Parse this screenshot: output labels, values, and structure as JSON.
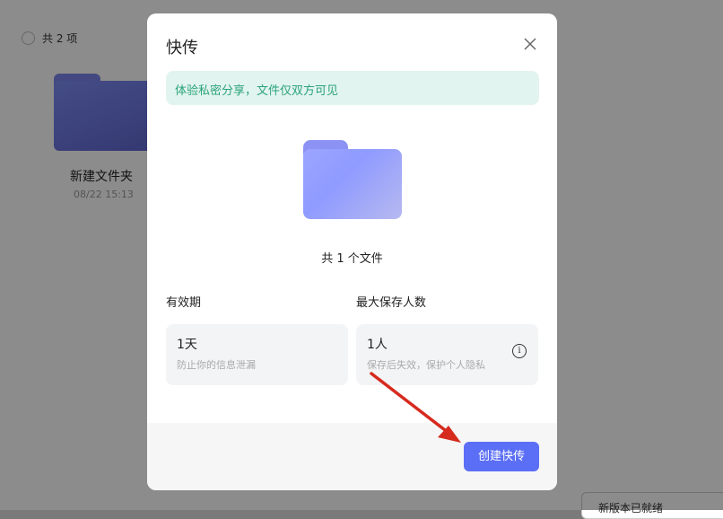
{
  "background": {
    "item_count": "共 2 项",
    "folder_name": "新建文件夹",
    "folder_date": "08/22 15:13",
    "bottom_button": "新版本已就绪"
  },
  "modal": {
    "title": "快传",
    "close_icon": "close-icon",
    "banner_text": "体验私密分享，文件仅双方可见",
    "file_count": "共 1 个文件",
    "validity": {
      "label": "有效期",
      "value": "1天",
      "hint": "防止你的信息泄漏"
    },
    "max_savers": {
      "label": "最大保存人数",
      "value": "1人",
      "hint": "保存后失效，保护个人隐私",
      "info_icon": "info-icon"
    },
    "create_button": "创建快传"
  },
  "colors": {
    "accent": "#5b6ef6",
    "banner_bg": "#e2f4ef",
    "banner_text": "#2aa37a",
    "annotation_arrow": "#d62a1e"
  }
}
